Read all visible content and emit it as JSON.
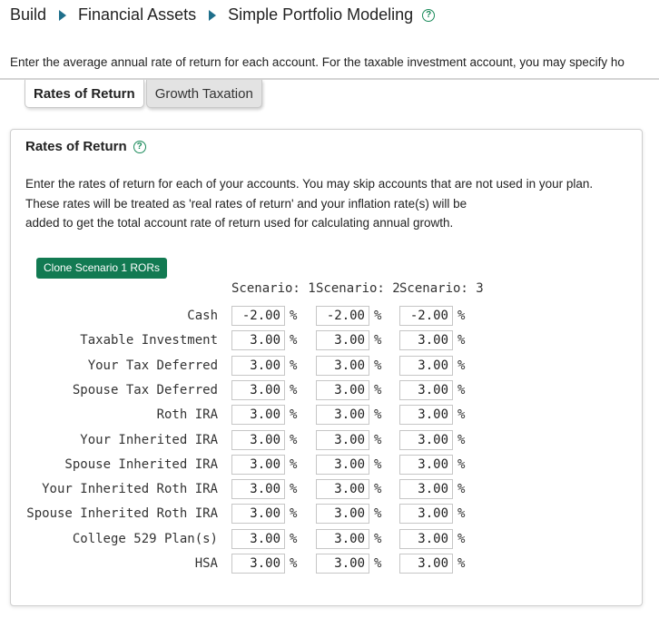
{
  "breadcrumb": {
    "items": [
      "Build",
      "Financial Assets",
      "Simple Portfolio Modeling"
    ],
    "help_icon": "question-circle-icon"
  },
  "intro_text": "Enter the average annual rate of return for each account. For the taxable investment account, you may specify ho",
  "tabs": [
    {
      "label": "Rates of Return",
      "active": true
    },
    {
      "label": "Growth Taxation",
      "active": false
    }
  ],
  "panel": {
    "title": "Rates of Return",
    "help_icon": "question-circle-icon",
    "description": [
      "Enter the rates of return for each of your accounts. You may skip accounts that are not used in your plan.",
      "These rates will be treated as 'real rates of return' and your inflation rate(s) will be",
      "added to get the total account rate of return used for calculating annual growth."
    ],
    "clone_button": "Clone Scenario 1 RORs",
    "columns": [
      "Scenario: 1",
      "Scenario: 2",
      "Scenario: 3"
    ],
    "percent_symbol": "%",
    "rows": [
      {
        "label": "Cash",
        "values": [
          "-2.00",
          "-2.00",
          "-2.00"
        ]
      },
      {
        "label": "Taxable Investment",
        "values": [
          "3.00",
          "3.00",
          "3.00"
        ]
      },
      {
        "label": "Your Tax Deferred",
        "values": [
          "3.00",
          "3.00",
          "3.00"
        ]
      },
      {
        "label": "Spouse Tax Deferred",
        "values": [
          "3.00",
          "3.00",
          "3.00"
        ]
      },
      {
        "label": "Roth IRA",
        "values": [
          "3.00",
          "3.00",
          "3.00"
        ]
      },
      {
        "label": "Your Inherited IRA",
        "values": [
          "3.00",
          "3.00",
          "3.00"
        ]
      },
      {
        "label": "Spouse Inherited IRA",
        "values": [
          "3.00",
          "3.00",
          "3.00"
        ]
      },
      {
        "label": "Your Inherited Roth IRA",
        "values": [
          "3.00",
          "3.00",
          "3.00"
        ]
      },
      {
        "label": "Spouse Inherited Roth IRA",
        "values": [
          "3.00",
          "3.00",
          "3.00"
        ]
      },
      {
        "label": "College 529 Plan(s)",
        "values": [
          "3.00",
          "3.00",
          "3.00"
        ]
      },
      {
        "label": "HSA",
        "values": [
          "3.00",
          "3.00",
          "3.00"
        ]
      }
    ]
  },
  "colors": {
    "accent": "#127a52",
    "breadcrumb_arrow": "#1f6f8b"
  }
}
